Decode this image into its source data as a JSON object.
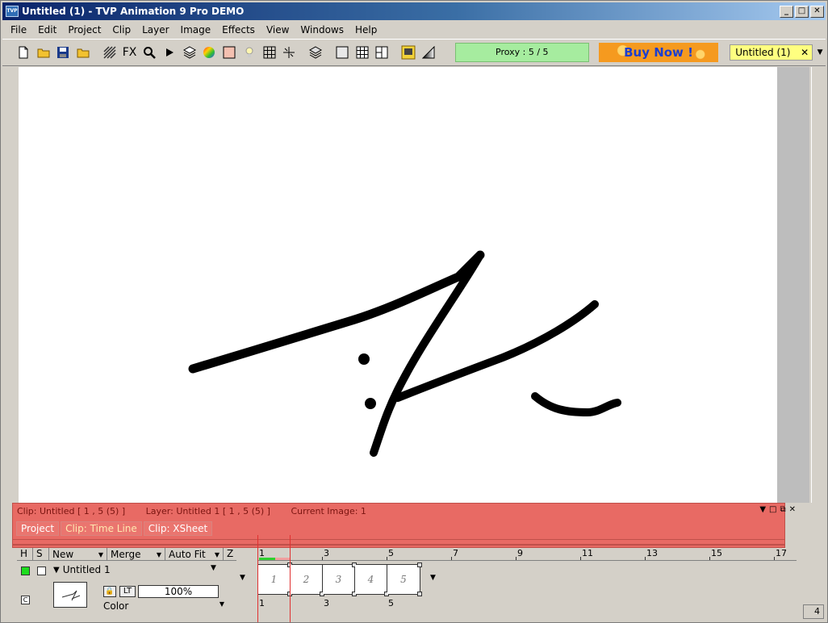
{
  "window": {
    "title": "Untitled (1) - TVP Animation 9 Pro DEMO",
    "app_icon": "TVP",
    "minimize": "_",
    "maximize": "□",
    "close": "✕"
  },
  "menu": [
    "File",
    "Edit",
    "Project",
    "Clip",
    "Layer",
    "Image",
    "Effects",
    "View",
    "Windows",
    "Help"
  ],
  "toolbar": {
    "fx_label": "FX",
    "proxy_label": "Proxy : 5 / 5",
    "buy_now_label": "Buy Now !",
    "document_select_value": "Untitled (1)",
    "document_select_close": "✕",
    "document_select_arrow": "▼"
  },
  "panel": {
    "clip_status": "Clip: Untitled [ 1 , 5  (5) ]",
    "layer_status": "Layer: Untitled 1 [ 1 , 5  (5) ]",
    "image_status": "Current Image: 1",
    "ctrl_arrow": "▼",
    "ctrl_maximize": "□",
    "ctrl_restore": "⧉",
    "ctrl_close": "✕",
    "tabs": [
      {
        "label": "Project",
        "active": false
      },
      {
        "label": "Clip: Time Line",
        "active": true
      },
      {
        "label": "Clip: XSheet",
        "active": false
      }
    ]
  },
  "layer_header": {
    "h": "H",
    "s": "S",
    "new": "New",
    "merge": "Merge",
    "autofit": "Auto Fit",
    "z": "Z"
  },
  "layer": {
    "name": "Untitled 1",
    "opacity": "100%",
    "lt": "LT",
    "lock": "🔒",
    "c": "C",
    "blend_mode": "Color"
  },
  "timeline": {
    "ruler": [
      "1",
      "3",
      "5",
      "7",
      "9",
      "11",
      "13",
      "15",
      "17"
    ],
    "frames": [
      "1",
      "2",
      "3",
      "4",
      "5"
    ],
    "bottom_ruler": [
      "1",
      "3",
      "5"
    ]
  },
  "corner_value": "4",
  "colors": {
    "title_bar": "#0a246a",
    "panel_red": "#e86a64",
    "proxy_green": "#a6ec9f",
    "buy_now_orange": "#f59a1f",
    "document_yellow": "#ffff80"
  }
}
